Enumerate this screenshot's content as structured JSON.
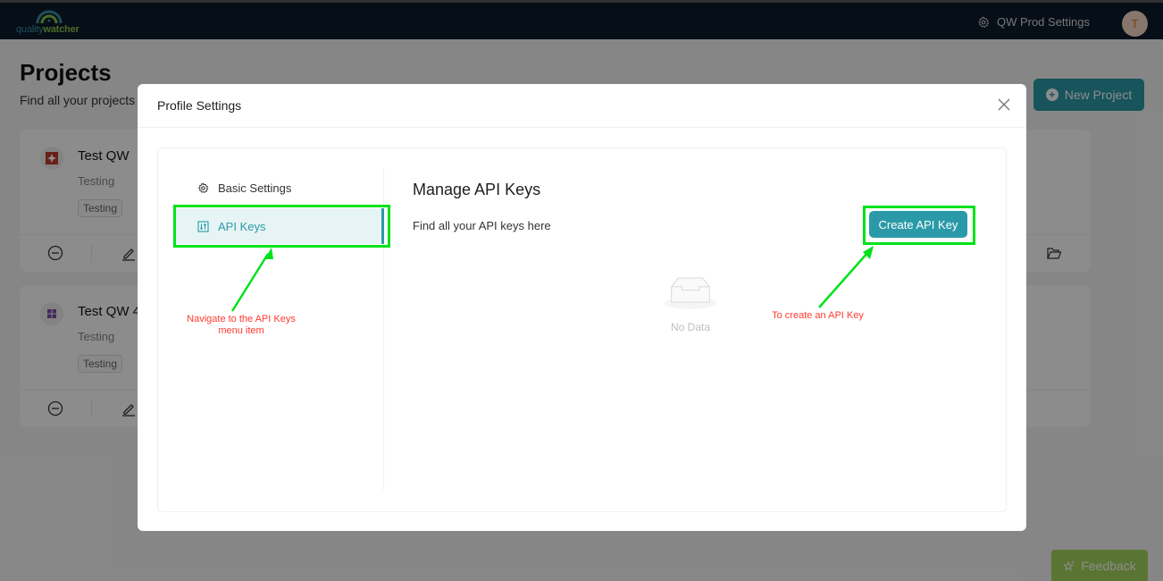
{
  "topbar": {
    "logo_text_part1": "quality",
    "logo_text_part2": "watcher",
    "org_settings_label": "QW Prod Settings",
    "org_settings_icon": "gear-icon",
    "avatar_initial": "T"
  },
  "page": {
    "title": "Projects",
    "subtitle": "Find all your projects",
    "new_project_label": "New Project",
    "new_project_icon": "plus-circle-icon"
  },
  "projects": [
    {
      "name": "Test QW",
      "description": "Testing",
      "tag": "Testing",
      "icon_color": "#c0392b"
    },
    {
      "name": "Test QW 4",
      "description": "Testing",
      "tag": "Testing",
      "icon_color": "#7b4fa8"
    }
  ],
  "card_actions": [
    "remove-icon",
    "edit-icon",
    "open-folder-icon"
  ],
  "feedback_label": "Feedback",
  "modal": {
    "title": "Profile Settings",
    "menu": [
      {
        "label": "Basic Settings",
        "icon": "gear-icon",
        "active": false
      },
      {
        "label": "API Keys",
        "icon": "api-key-icon",
        "active": true
      }
    ],
    "content": {
      "title": "Manage API Keys",
      "subtitle": "Find all your API keys here",
      "create_button_label": "Create API Key",
      "empty_text": "No Data"
    }
  },
  "annotations": {
    "menu_note": "Navigate to the API Keys menu item",
    "create_note": "To create an API Key",
    "highlight_color": "#00e21a",
    "note_color": "#ff3b30"
  },
  "colors": {
    "brand": "#2b9aa8",
    "topbar": "#0b1b2b",
    "feedback": "#a4d65e"
  }
}
